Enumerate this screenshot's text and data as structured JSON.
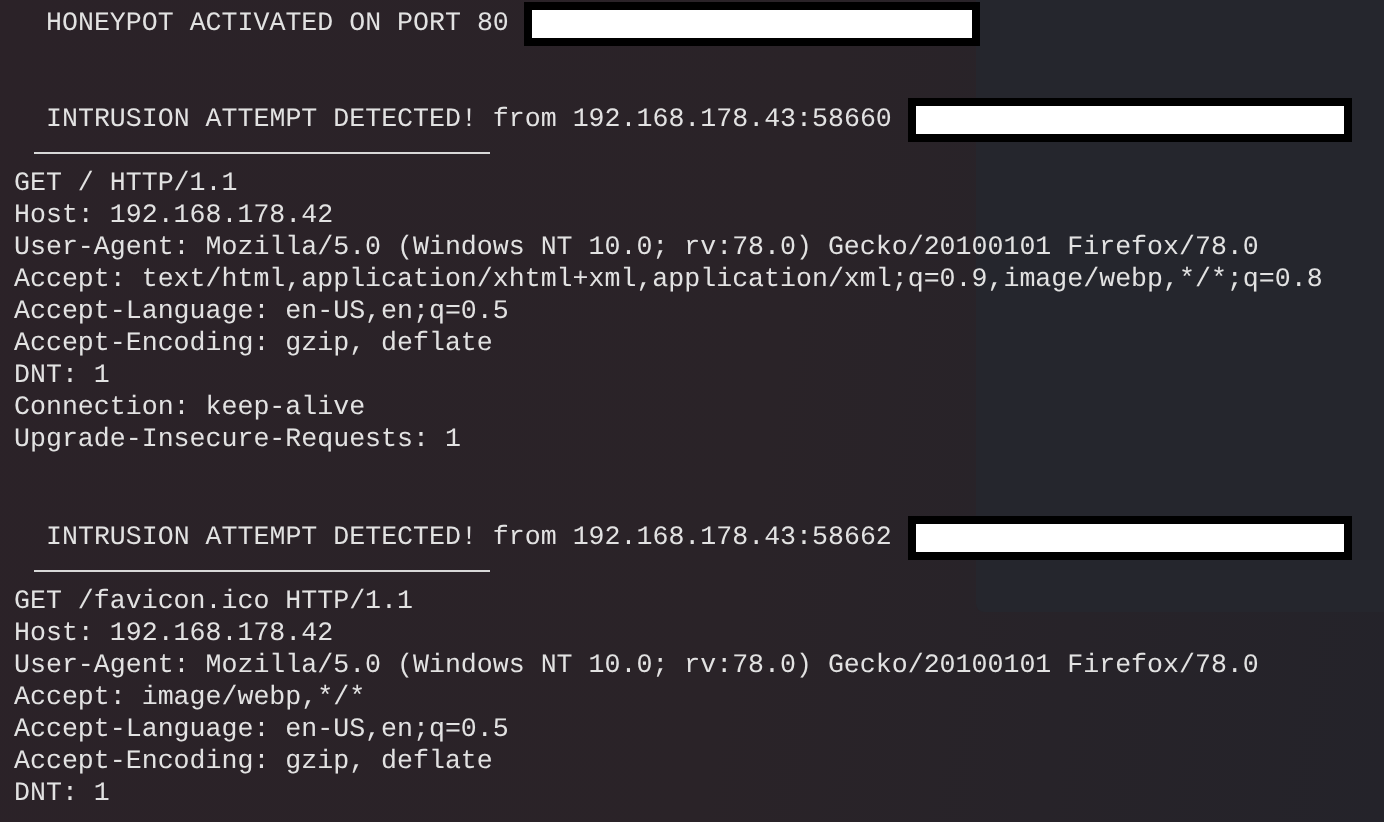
{
  "header": {
    "text": "HONEYPOT ACTIVATED ON PORT 80",
    "redacted": true
  },
  "requests": [
    {
      "heading": "INTRUSION ATTEMPT DETECTED! from 192.168.178.43:58660",
      "redacted": true,
      "lines": [
        "GET / HTTP/1.1",
        "Host: 192.168.178.42",
        "User-Agent: Mozilla/5.0 (Windows NT 10.0; rv:78.0) Gecko/20100101 Firefox/78.0",
        "Accept: text/html,application/xhtml+xml,application/xml;q=0.9,image/webp,*/*;q=0.8",
        "Accept-Language: en-US,en;q=0.5",
        "Accept-Encoding: gzip, deflate",
        "DNT: 1",
        "Connection: keep-alive",
        "Upgrade-Insecure-Requests: 1"
      ]
    },
    {
      "heading": "INTRUSION ATTEMPT DETECTED! from 192.168.178.43:58662",
      "redacted": true,
      "lines": [
        "GET /favicon.ico HTTP/1.1",
        "Host: 192.168.178.42",
        "User-Agent: Mozilla/5.0 (Windows NT 10.0; rv:78.0) Gecko/20100101 Firefox/78.0",
        "Accept: image/webp,*/*",
        "Accept-Language: en-US,en;q=0.5",
        "Accept-Encoding: gzip, deflate",
        "DNT: 1"
      ]
    }
  ]
}
